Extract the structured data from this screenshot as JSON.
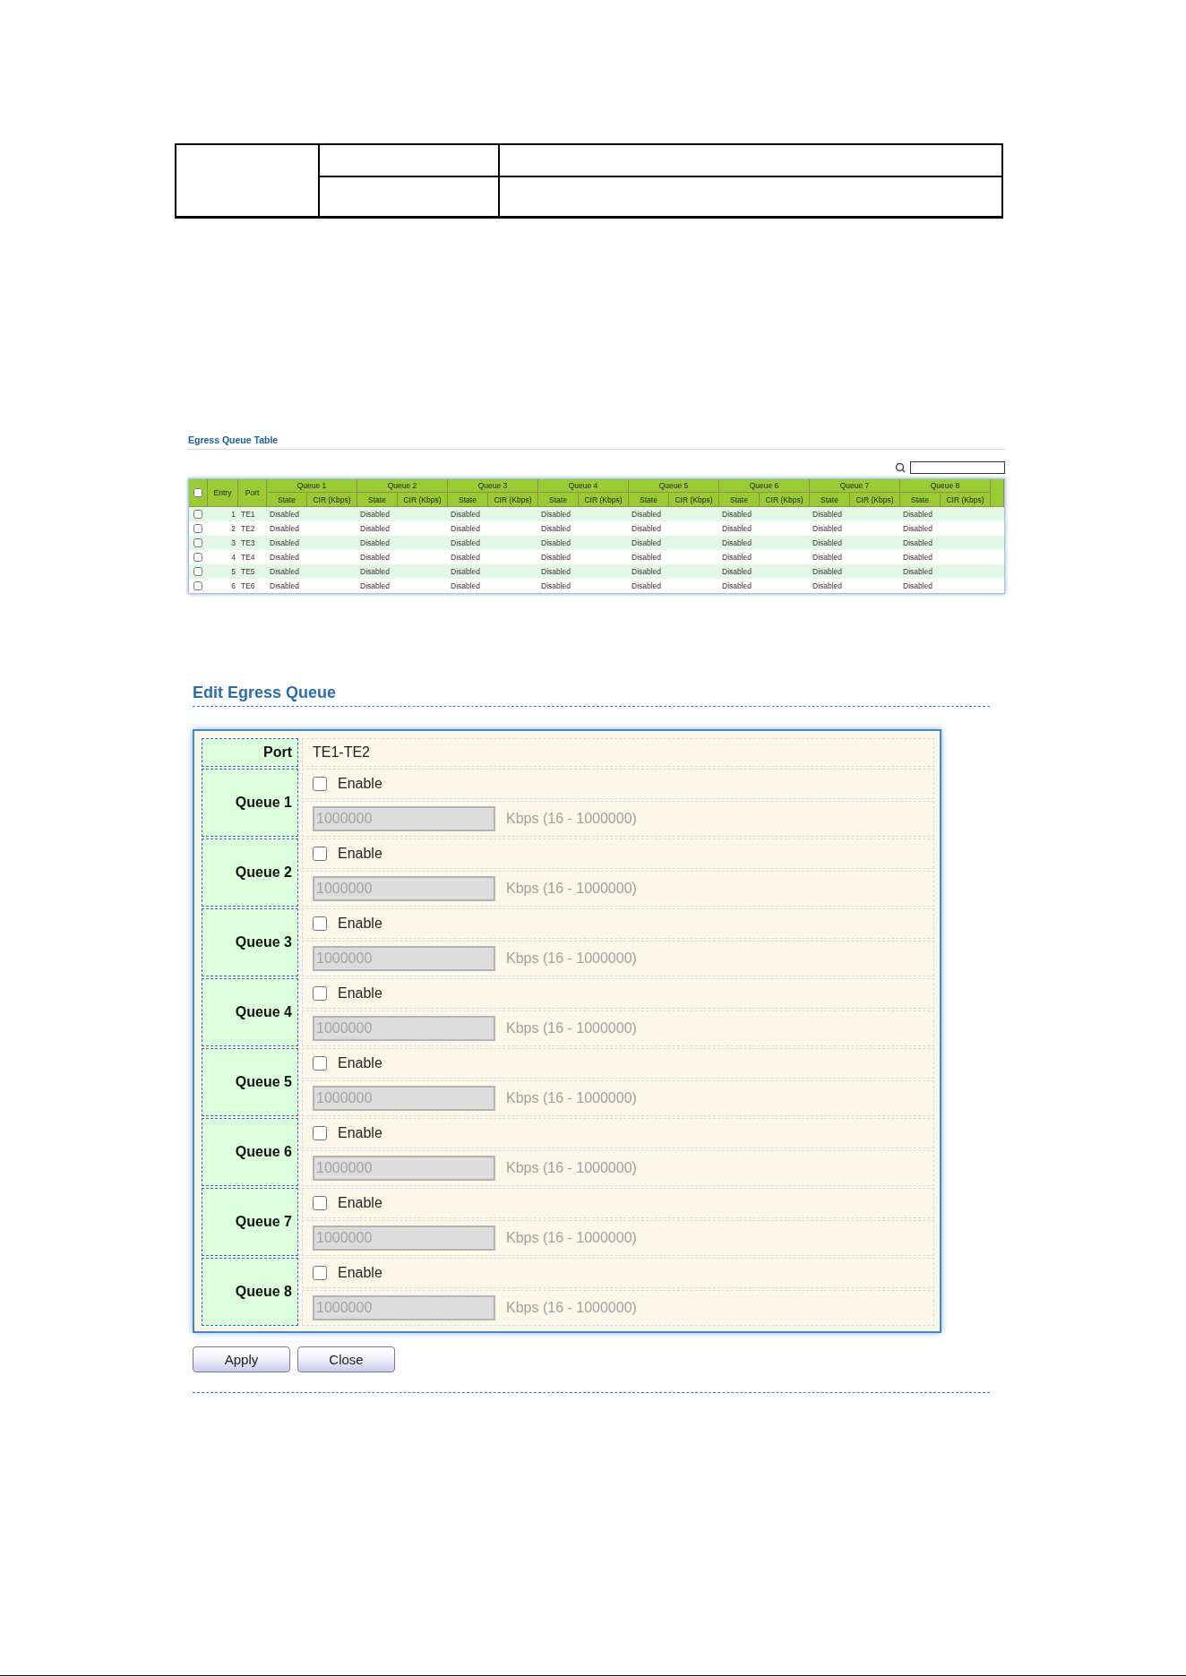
{
  "egress_table": {
    "title": "Egress Queue Table",
    "select_all": {
      "checked": false
    },
    "headers": {
      "entry": "Entry",
      "port": "Port"
    },
    "queues": [
      {
        "label": "Queue 1",
        "columns": [
          "State",
          "CIR (Kbps)"
        ]
      },
      {
        "label": "Queue 2",
        "columns": [
          "State",
          "CIR (Kbps)"
        ]
      },
      {
        "label": "Queue 3",
        "columns": [
          "State",
          "CIR (Kbps)"
        ]
      },
      {
        "label": "Queue 4",
        "columns": [
          "State",
          "CIR (Kbps)"
        ]
      },
      {
        "label": "Queue 5",
        "columns": [
          "State",
          "CIR (Kbps)"
        ]
      },
      {
        "label": "Queue 6",
        "columns": [
          "State",
          "CIR (Kbps)"
        ]
      },
      {
        "label": "Queue 7",
        "columns": [
          "State",
          "CIR (Kbps)"
        ]
      },
      {
        "label": "Queue 8",
        "columns": [
          "State",
          "CIR (Kbps)"
        ]
      }
    ],
    "rows": [
      {
        "checked": false,
        "entry": "1",
        "port": "TE1",
        "states": [
          "Disabled",
          "Disabled",
          "Disabled",
          "Disabled",
          "Disabled",
          "Disabled",
          "Disabled",
          "Disabled"
        ]
      },
      {
        "checked": false,
        "entry": "2",
        "port": "TE2",
        "states": [
          "Disabled",
          "Disabled",
          "Disabled",
          "Disabled",
          "Disabled",
          "Disabled",
          "Disabled",
          "Disabled"
        ]
      },
      {
        "checked": false,
        "entry": "3",
        "port": "TE3",
        "states": [
          "Disabled",
          "Disabled",
          "Disabled",
          "Disabled",
          "Disabled",
          "Disabled",
          "Disabled",
          "Disabled"
        ]
      },
      {
        "checked": false,
        "entry": "4",
        "port": "TE4",
        "states": [
          "Disabled",
          "Disabled",
          "Disabled",
          "Disabled",
          "Disabled",
          "Disabled",
          "Disabled",
          "Disabled"
        ]
      },
      {
        "checked": false,
        "entry": "5",
        "port": "TE5",
        "states": [
          "Disabled",
          "Disabled",
          "Disabled",
          "Disabled",
          "Disabled",
          "Disabled",
          "Disabled",
          "Disabled"
        ]
      },
      {
        "checked": false,
        "entry": "6",
        "port": "TE6",
        "states": [
          "Disabled",
          "Disabled",
          "Disabled",
          "Disabled",
          "Disabled",
          "Disabled",
          "Disabled",
          "Disabled"
        ]
      }
    ]
  },
  "edit_form": {
    "title": "Edit Egress Queue",
    "port": {
      "label": "Port",
      "value": "TE1-TE2"
    },
    "queues": [
      {
        "label": "Queue 1",
        "enable": {
          "label": "Enable",
          "checked": false
        },
        "rate": {
          "value": "1000000",
          "disabled": true
        },
        "hint": "Kbps (16 - 1000000)"
      },
      {
        "label": "Queue 2",
        "enable": {
          "label": "Enable",
          "checked": false
        },
        "rate": {
          "value": "1000000",
          "disabled": true
        },
        "hint": "Kbps (16 - 1000000)"
      },
      {
        "label": "Queue 3",
        "enable": {
          "label": "Enable",
          "checked": false
        },
        "rate": {
          "value": "1000000",
          "disabled": true
        },
        "hint": "Kbps (16 - 1000000)"
      },
      {
        "label": "Queue 4",
        "enable": {
          "label": "Enable",
          "checked": false
        },
        "rate": {
          "value": "1000000",
          "disabled": true
        },
        "hint": "Kbps (16 - 1000000)"
      },
      {
        "label": "Queue 5",
        "enable": {
          "label": "Enable",
          "checked": false
        },
        "rate": {
          "value": "1000000",
          "disabled": true
        },
        "hint": "Kbps (16 - 1000000)"
      },
      {
        "label": "Queue 6",
        "enable": {
          "label": "Enable",
          "checked": false
        },
        "rate": {
          "value": "1000000",
          "disabled": true
        },
        "hint": "Kbps (16 - 1000000)"
      },
      {
        "label": "Queue 7",
        "enable": {
          "label": "Enable",
          "checked": false
        },
        "rate": {
          "value": "1000000",
          "disabled": true
        },
        "hint": "Kbps (16 - 1000000)"
      },
      {
        "label": "Queue 8",
        "enable": {
          "label": "Enable",
          "checked": false
        },
        "rate": {
          "value": "1000000",
          "disabled": true
        },
        "hint": "Kbps (16 - 1000000)"
      }
    ],
    "buttons": [
      {
        "label": "Apply"
      },
      {
        "label": "Close"
      }
    ]
  }
}
